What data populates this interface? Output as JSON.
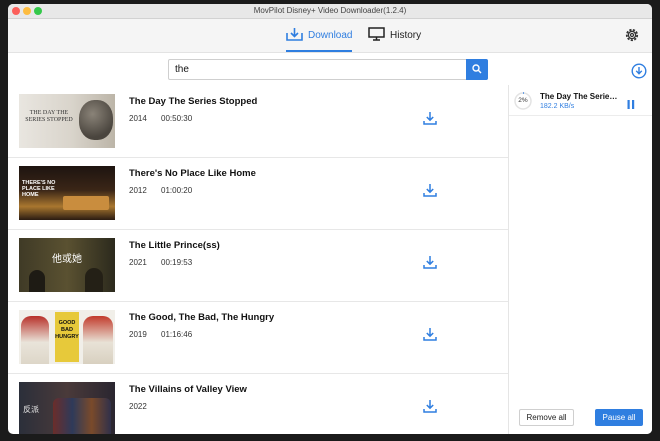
{
  "window": {
    "title": "MovPilot Disney+ Video Downloader(1.2.4)"
  },
  "tabs": [
    {
      "label": "Download",
      "active": true
    },
    {
      "label": "History",
      "active": false
    }
  ],
  "search": {
    "value": "the",
    "placeholder": ""
  },
  "results": [
    {
      "title": "The Day The Series Stopped",
      "year": "2014",
      "duration": "00:50:30",
      "thumb_text": "THE DAY THE SERIES STOPPED"
    },
    {
      "title": "There's No Place Like Home",
      "year": "2012",
      "duration": "01:00:20",
      "thumb_text": "THERE'S NO PLACE LIKE HOME"
    },
    {
      "title": "The Little Prince(ss)",
      "year": "2021",
      "duration": "00:19:53",
      "thumb_text": "他或她"
    },
    {
      "title": "The Good, The Bad, The Hungry",
      "year": "2019",
      "duration": "01:16:46",
      "thumb_text": "GOOD BAD HUNGRY"
    },
    {
      "title": "The Villains of Valley View",
      "year": "2022",
      "duration": "",
      "thumb_text": "反派"
    }
  ],
  "queue": [
    {
      "title": "The Day The Series Stopped",
      "progress": "2%",
      "progress_fraction": 0.02,
      "speed": "182.2 KB/s"
    }
  ],
  "buttons": {
    "remove_all": "Remove all",
    "pause_all": "Pause all"
  },
  "colors": {
    "accent": "#2f7ee0"
  }
}
